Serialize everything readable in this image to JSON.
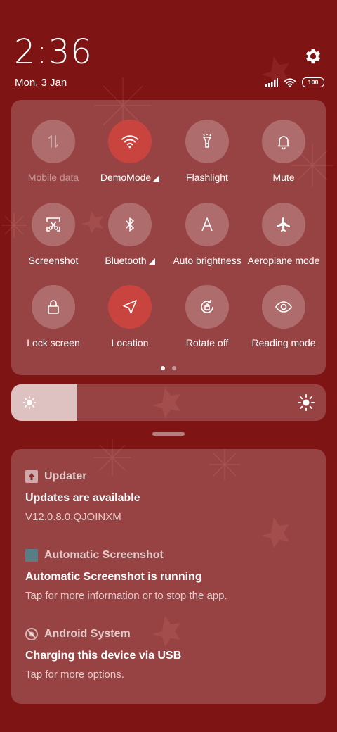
{
  "status": {
    "time": "2:36",
    "date": "Mon, 3 Jan",
    "battery": "100"
  },
  "quick_settings": {
    "tiles": [
      {
        "label": "Mobile data",
        "icon": "mobile-data-icon",
        "active": false,
        "disabled": true,
        "expandable": false
      },
      {
        "label": "DemoMode",
        "icon": "wifi-icon",
        "active": true,
        "disabled": false,
        "expandable": true
      },
      {
        "label": "Flashlight",
        "icon": "flashlight-icon",
        "active": false,
        "disabled": false,
        "expandable": false
      },
      {
        "label": "Mute",
        "icon": "bell-icon",
        "active": false,
        "disabled": false,
        "expandable": false
      },
      {
        "label": "Screenshot",
        "icon": "screenshot-icon",
        "active": false,
        "disabled": false,
        "expandable": false
      },
      {
        "label": "Bluetooth",
        "icon": "bluetooth-icon",
        "active": false,
        "disabled": false,
        "expandable": true
      },
      {
        "label": "Auto brightness",
        "icon": "auto-brightness-icon",
        "active": false,
        "disabled": false,
        "expandable": false
      },
      {
        "label": "Aeroplane mode",
        "icon": "airplane-icon",
        "active": false,
        "disabled": false,
        "expandable": false
      },
      {
        "label": "Lock screen",
        "icon": "lock-icon",
        "active": false,
        "disabled": false,
        "expandable": false
      },
      {
        "label": "Location",
        "icon": "location-icon",
        "active": true,
        "disabled": false,
        "expandable": false
      },
      {
        "label": "Rotate off",
        "icon": "rotate-lock-icon",
        "active": false,
        "disabled": false,
        "expandable": false
      },
      {
        "label": "Reading mode",
        "icon": "eye-icon",
        "active": false,
        "disabled": false,
        "expandable": false
      }
    ],
    "page_count": 2,
    "current_page": 0
  },
  "brightness": {
    "level": 0.21
  },
  "notifications": [
    {
      "app": "Updater",
      "icon": "updater-icon",
      "title": "Updates are available",
      "body": "V12.0.8.0.QJOINXM"
    },
    {
      "app": "Automatic Screenshot",
      "icon": "app-square-icon",
      "title": "Automatic Screenshot is running",
      "body": "Tap for more information or to stop the app."
    },
    {
      "app": "Android System",
      "icon": "android-system-icon",
      "title": "Charging this device via USB",
      "body": "Tap for more options."
    }
  ],
  "colors": {
    "background": "#7f1414",
    "active_tile": "#c9443f"
  }
}
